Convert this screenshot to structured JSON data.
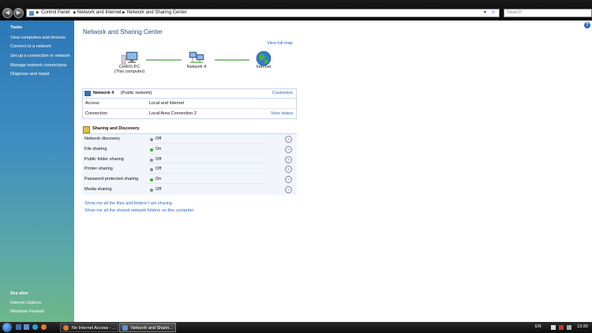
{
  "address_bar": {
    "crumbs": [
      "Control Panel",
      "Network and Internet",
      "Network and Sharing Center"
    ],
    "search_placeholder": "Search"
  },
  "sidebar": {
    "tasks_heading": "Tasks",
    "tasks": [
      "View computers and devices",
      "Connect to a network",
      "Set up a connection or network",
      "Manage network connections",
      "Diagnose and repair"
    ],
    "see_also_heading": "See also",
    "see_also": [
      "Internet Options",
      "Windows Firewall"
    ]
  },
  "main": {
    "title": "Network and Sharing Center",
    "help": "?",
    "view_full_map": "View full map",
    "map": {
      "computer_name": "CHRIS-PC",
      "computer_sub": "(This computer)",
      "network_name": "Network 4",
      "internet_label": "Internet"
    },
    "network": {
      "name": "Network  4",
      "type": "(Public network)",
      "customize": "Customize",
      "rows": [
        {
          "label": "Access",
          "value": "Local and Internet",
          "action": ""
        },
        {
          "label": "Connection",
          "value": "Local Area Connection 2",
          "action": "View status"
        }
      ]
    },
    "sharing": {
      "heading": "Sharing and Discovery",
      "rows": [
        {
          "label": "Network discovery",
          "status": "Off"
        },
        {
          "label": "File sharing",
          "status": "On"
        },
        {
          "label": "Public folder sharing",
          "status": "Off"
        },
        {
          "label": "Printer sharing",
          "status": "Off"
        },
        {
          "label": "Password protected sharing",
          "status": "On"
        },
        {
          "label": "Media sharing",
          "status": "Off"
        }
      ]
    },
    "links": [
      "Show me all the files and folders I am sharing",
      "Show me all the shared network folders on this computer"
    ]
  },
  "taskbar": {
    "buttons": [
      {
        "label": "No Internet Access - ..."
      },
      {
        "label": "Network and Sharin..."
      }
    ],
    "language": "EN",
    "time": "13:39"
  },
  "colors": {
    "status_on": "#3fae2a",
    "status_off": "#8a8a8a",
    "link": "#2a6bc4",
    "title": "#2a4d86"
  }
}
